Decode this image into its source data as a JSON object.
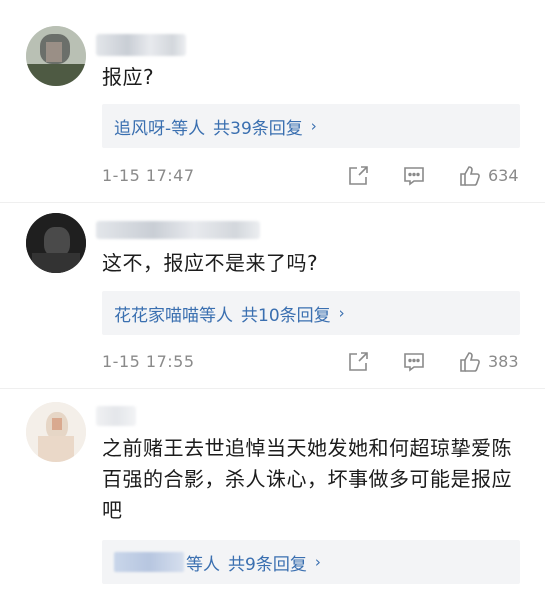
{
  "comments": [
    {
      "text": "报应?",
      "reply": {
        "who": "追风呀-",
        "etc": "等人",
        "count": "共39条回复",
        "arrow": "›"
      },
      "time": "1-15 17:47",
      "likes": "634"
    },
    {
      "text": "这不，报应不是来了吗?",
      "reply": {
        "who": "花花家喵喵",
        "etc": "等人",
        "count": "共10条回复",
        "arrow": "›"
      },
      "time": "1-15 17:55",
      "likes": "383"
    },
    {
      "text": "之前赌王去世追悼当天她发她和何超琼挚爱陈百强的合影，杀人诛心，坏事做多可能是报应吧",
      "reply": {
        "who": "",
        "etc": "等人",
        "count": "共9条回复",
        "arrow": "›"
      }
    }
  ],
  "icons": {
    "share": "share-icon",
    "comment": "comment-icon",
    "like": "thumbs-up-icon"
  },
  "colors": {
    "link": "#3a6fb0",
    "meta": "#8a8a8a",
    "reply_bg": "#f3f4f6"
  }
}
